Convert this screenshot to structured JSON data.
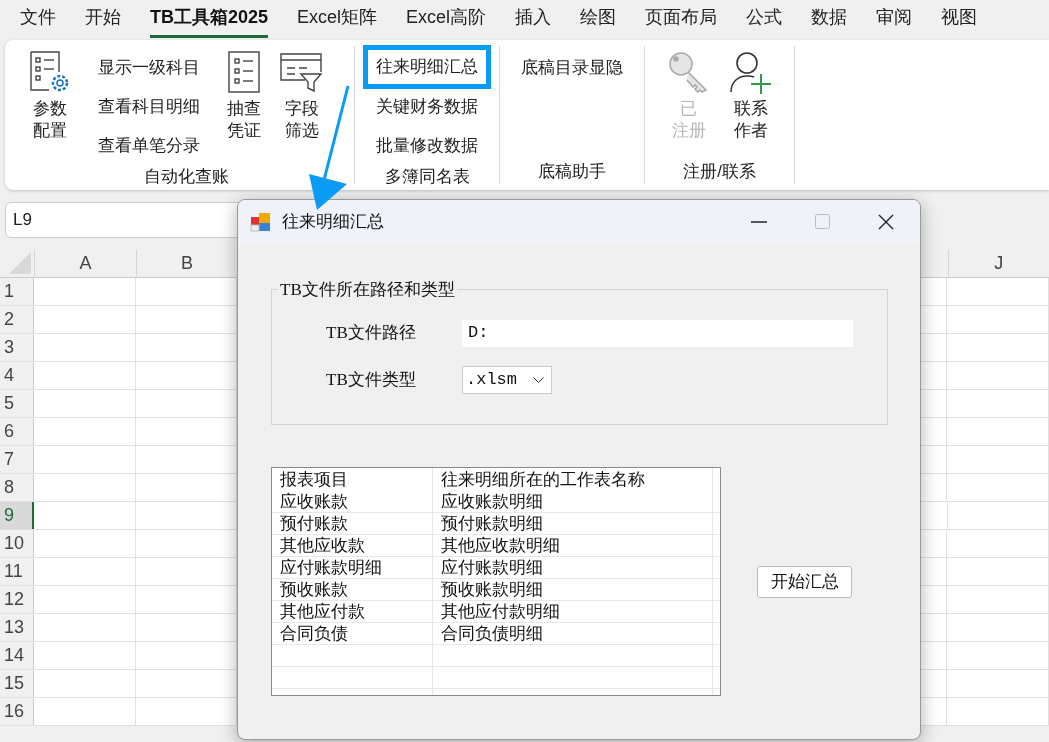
{
  "menu_tabs": [
    {
      "label": "文件",
      "selected": false
    },
    {
      "label": "开始",
      "selected": false
    },
    {
      "label": "TB工具箱2025",
      "selected": true
    },
    {
      "label": "Excel矩阵",
      "selected": false
    },
    {
      "label": "Excel高阶",
      "selected": false
    },
    {
      "label": "插入",
      "selected": false
    },
    {
      "label": "绘图",
      "selected": false
    },
    {
      "label": "页面布局",
      "selected": false
    },
    {
      "label": "公式",
      "selected": false
    },
    {
      "label": "数据",
      "selected": false
    },
    {
      "label": "审阅",
      "selected": false
    },
    {
      "label": "视图",
      "selected": false
    }
  ],
  "ribbon": {
    "groups": [
      {
        "label": "自动化查账",
        "items": [
          {
            "kind": "large",
            "lines": [
              "参数",
              "配置"
            ],
            "disabled": false
          },
          {
            "kind": "stack",
            "buttons": [
              {
                "label": "显示一级科目",
                "highlighted": false
              },
              {
                "label": "查看科目明细",
                "highlighted": false
              },
              {
                "label": "查看单笔分录",
                "highlighted": false
              }
            ]
          },
          {
            "kind": "large",
            "lines": [
              "抽查",
              "凭证"
            ],
            "disabled": false
          },
          {
            "kind": "large",
            "lines": [
              "字段",
              "筛选"
            ],
            "disabled": false
          }
        ]
      },
      {
        "label": "多簿同名表",
        "items": [
          {
            "kind": "stack",
            "buttons": [
              {
                "label": "往来明细汇总",
                "highlighted": true
              },
              {
                "label": "关键财务数据",
                "highlighted": false
              },
              {
                "label": "批量修改数据",
                "highlighted": false
              }
            ]
          }
        ]
      },
      {
        "label": "底稿助手",
        "items": [
          {
            "kind": "stack",
            "buttons": [
              {
                "label": "底稿目录显隐",
                "highlighted": false
              }
            ]
          }
        ]
      },
      {
        "label": "注册/联系",
        "items": [
          {
            "kind": "large",
            "lines": [
              "已",
              "注册"
            ],
            "disabled": true
          },
          {
            "kind": "large",
            "lines": [
              "联系",
              "作者"
            ],
            "disabled": false
          }
        ]
      }
    ]
  },
  "name_box": "L9",
  "sheet": {
    "left_columns": [
      "A",
      "B"
    ],
    "right_column": "J",
    "rows": [
      {
        "label": "1",
        "selected": false
      },
      {
        "label": "2",
        "selected": false
      },
      {
        "label": "3",
        "selected": false
      },
      {
        "label": "4",
        "selected": false
      },
      {
        "label": "5",
        "selected": false
      },
      {
        "label": "6",
        "selected": false
      },
      {
        "label": "7",
        "selected": false
      },
      {
        "label": "8",
        "selected": false
      },
      {
        "label": "9",
        "selected": true
      },
      {
        "label": "10",
        "selected": false
      },
      {
        "label": "11",
        "selected": false
      },
      {
        "label": "12",
        "selected": false
      },
      {
        "label": "13",
        "selected": false
      },
      {
        "label": "14",
        "selected": false
      },
      {
        "label": "15",
        "selected": false
      },
      {
        "label": "16",
        "selected": false
      }
    ]
  },
  "dialog": {
    "title": "往来明细汇总",
    "group": {
      "legend": "TB文件所在路径和类型",
      "path_label": "TB文件路径",
      "path_value": "D:",
      "type_label": "TB文件类型",
      "type_value": ".xlsm"
    },
    "table": {
      "columns": [
        "报表项目",
        "往来明细所在的工作表名称"
      ],
      "rows": [
        [
          "应收账款",
          "应收账款明细"
        ],
        [
          "预付账款",
          "预付账款明细"
        ],
        [
          "其他应收款",
          "其他应收款明细"
        ],
        [
          "应付账款明细",
          "应付账款明细"
        ],
        [
          "预收账款",
          "预收账款明细"
        ],
        [
          "其他应付款",
          "其他应付款明细"
        ],
        [
          "合同负债",
          "合同负债明细"
        ]
      ]
    },
    "button": "开始汇总"
  }
}
